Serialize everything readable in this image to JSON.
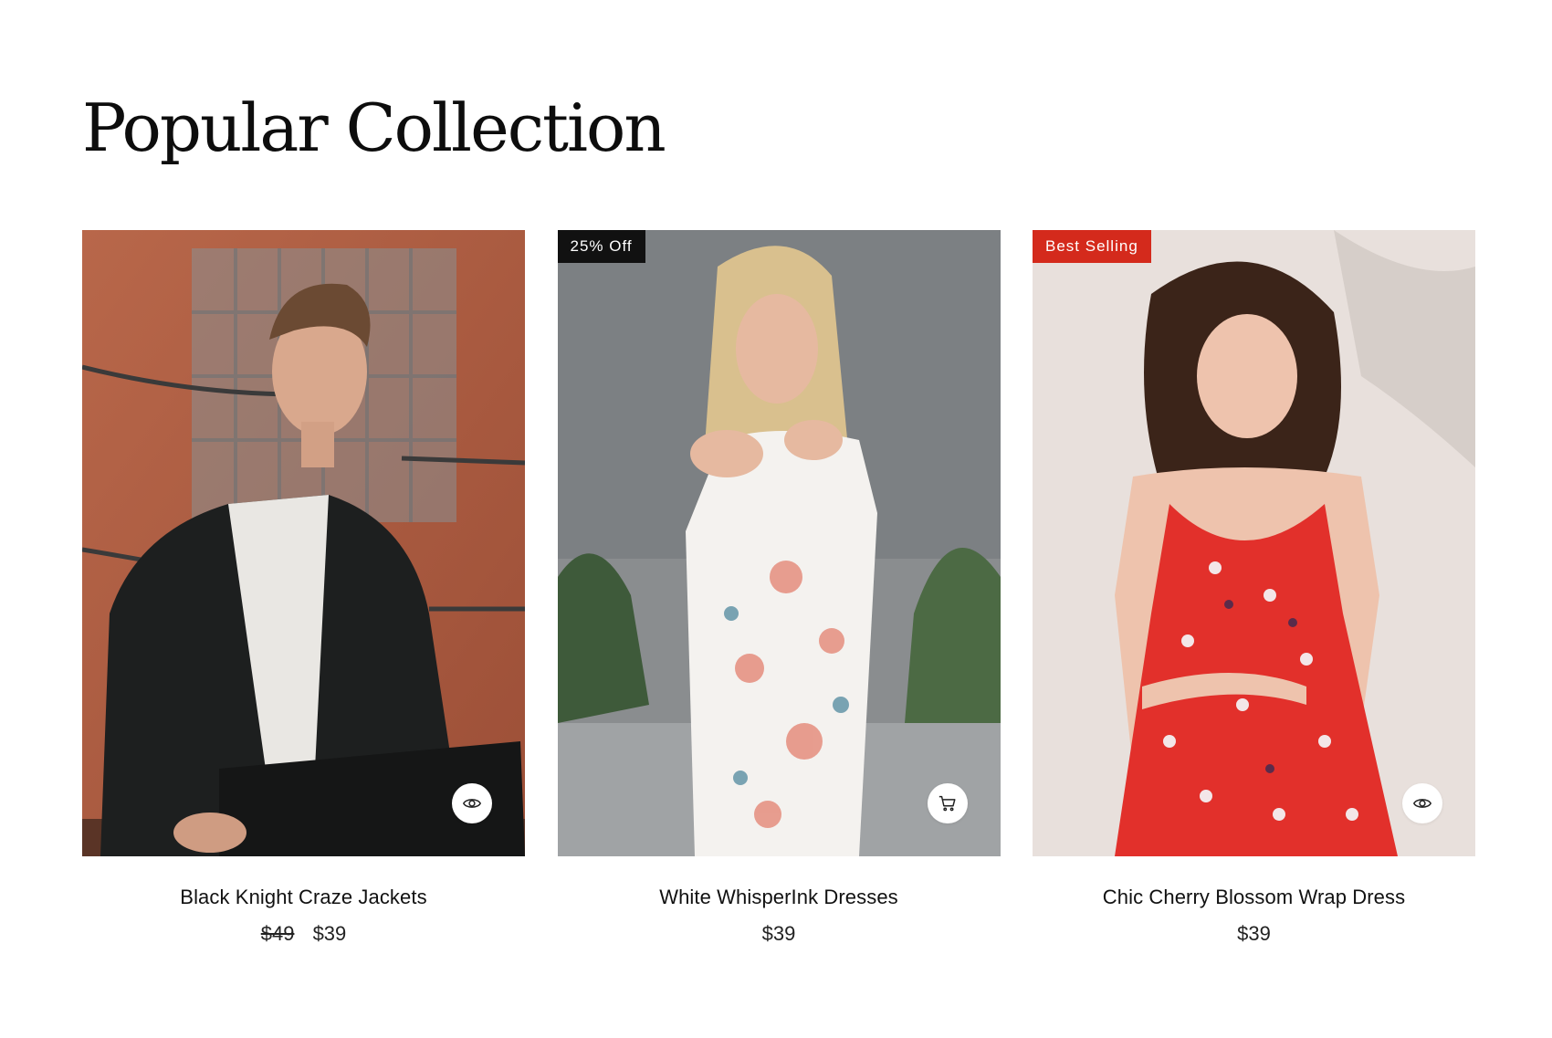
{
  "section": {
    "title": "Popular Collection"
  },
  "products": [
    {
      "title": "Black Knight Craze Jackets",
      "old_price": "$49",
      "price": "$39",
      "badge": "",
      "action_icon": "eye-icon"
    },
    {
      "title": "White WhisperInk Dresses",
      "old_price": "",
      "price": "$39",
      "badge": "25% Off",
      "action_icon": "cart-icon"
    },
    {
      "title": "Chic Cherry Blossom Wrap Dress",
      "old_price": "",
      "price": "$39",
      "badge": "Best Selling",
      "action_icon": "eye-icon"
    }
  ],
  "colors": {
    "badge_dark": "#111111",
    "badge_red": "#d42a1c",
    "text": "#111111"
  }
}
